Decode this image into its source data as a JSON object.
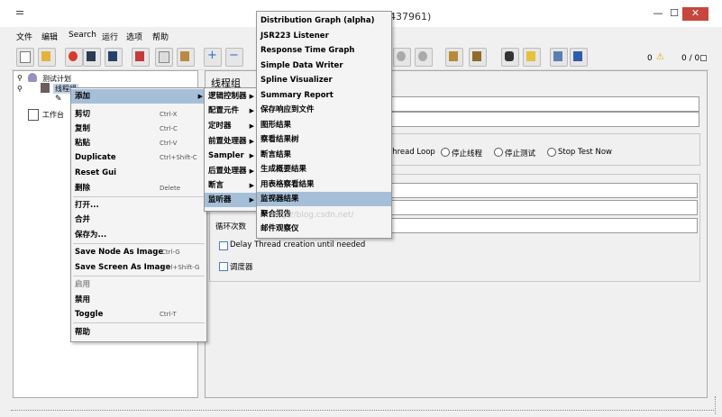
{
  "window": {
    "title_fragment": "437961)",
    "min_glyph": "—",
    "max_glyph": "☐",
    "close_glyph": "✕"
  },
  "menubar": [
    "文件",
    "编辑",
    "Search",
    "运行",
    "选项",
    "帮助"
  ],
  "toolbar": {
    "status_left": "0",
    "warning_glyph": "⚠",
    "status_right": "0 / 0"
  },
  "tree": {
    "root": "测试计划",
    "child": "线程组",
    "workbench": "工作台"
  },
  "right_panel": {
    "title": "线程组",
    "radio_labels": [
      "Thread Loop",
      "停止线程",
      "停止测试",
      "Stop Test Now"
    ],
    "loop_label": "循环次数",
    "delay_label": "Delay Thread creation until needed",
    "scheduler_label": "调度器"
  },
  "context_menu": {
    "items": [
      {
        "label": "添加",
        "shortcut": "",
        "arrow": true,
        "highlight": true
      },
      {
        "label": "剪切",
        "shortcut": "Ctrl-X"
      },
      {
        "label": "复制",
        "shortcut": "Ctrl-C"
      },
      {
        "label": "粘贴",
        "shortcut": "Ctrl-V"
      },
      {
        "label": "Duplicate",
        "shortcut": "Ctrl+Shift-C"
      },
      {
        "label": "Reset Gui",
        "shortcut": ""
      },
      {
        "label": "删除",
        "shortcut": "Delete"
      },
      {
        "label": "打开...",
        "shortcut": ""
      },
      {
        "label": "合并",
        "shortcut": ""
      },
      {
        "label": "保存为...",
        "shortcut": ""
      },
      {
        "label": "Save Node As Image",
        "shortcut": "Ctrl-G"
      },
      {
        "label": "Save Screen As Image",
        "shortcut": "Ctrl+Shift-G"
      },
      {
        "label": "启用",
        "shortcut": "",
        "disabled": true
      },
      {
        "label": "禁用",
        "shortcut": ""
      },
      {
        "label": "Toggle",
        "shortcut": "Ctrl-T"
      },
      {
        "label": "帮助",
        "shortcut": ""
      }
    ]
  },
  "add_submenu": {
    "items": [
      "逻辑控制器",
      "配置元件",
      "定时器",
      "前置处理器",
      "Sampler",
      "后置处理器",
      "断言",
      "监听器"
    ],
    "highlight_index": 7
  },
  "listener_submenu": {
    "items": [
      "Distribution Graph (alpha)",
      "JSR223 Listener",
      "Response Time Graph",
      "Simple Data Writer",
      "Spline Visualizer",
      "Summary Report",
      "保存响应到文件",
      "图形结果",
      "察看结果树",
      "断言结果",
      "生成概要结果",
      "用表格察看结果",
      "监视器结果",
      "聚合报告",
      "邮件观察仪"
    ],
    "highlight_index": 12
  },
  "watermark": "http://blog.csdn.net/"
}
